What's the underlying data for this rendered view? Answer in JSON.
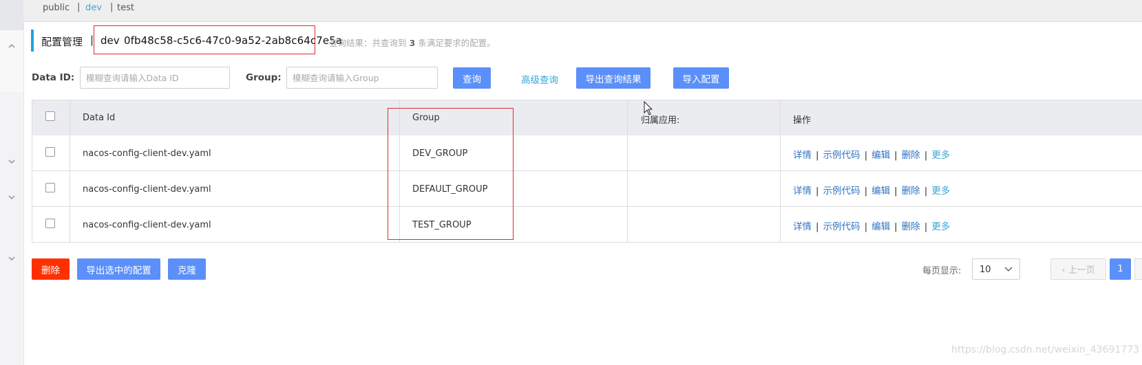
{
  "namespaces": [
    {
      "label": "public"
    },
    {
      "label": "dev"
    },
    {
      "label": "test"
    }
  ],
  "header": {
    "title": "配置管理",
    "separator": "|",
    "namespace_name": "dev",
    "namespace_id": "0fb48c58-c5c6-47c0-9a52-2ab8c64c7e5a",
    "result_prefix": "查询结果：共查询到",
    "result_count": "3",
    "result_suffix": "条满足要求的配置。"
  },
  "search": {
    "data_id_label": "Data ID:",
    "data_id_placeholder": "模糊查询请输入Data ID",
    "group_label": "Group:",
    "group_placeholder": "模糊查询请输入Group",
    "query_button": "查询",
    "advanced_link": "高级查询",
    "export_results_button": "导出查询结果",
    "import_button": "导入配置"
  },
  "table": {
    "columns": [
      "Data Id",
      "Group",
      "归属应用:",
      "操作"
    ],
    "rows": [
      {
        "data_id": "nacos-config-client-dev.yaml",
        "group": "DEV_GROUP",
        "app": ""
      },
      {
        "data_id": "nacos-config-client-dev.yaml",
        "group": "DEFAULT_GROUP",
        "app": ""
      },
      {
        "data_id": "nacos-config-client-dev.yaml",
        "group": "TEST_GROUP",
        "app": ""
      }
    ],
    "actions": {
      "detail": "详情",
      "sample": "示例代码",
      "edit": "编辑",
      "delete": "删除",
      "more": "更多"
    }
  },
  "footer": {
    "delete_button": "删除",
    "export_selected_button": "导出选中的配置",
    "clone_button": "克隆",
    "page_size_label": "每页显示:",
    "page_size_value": "10",
    "prev_button": "上一页",
    "current_page": "1"
  },
  "watermark": "https://blog.csdn.net/weixin_43691773",
  "colors": {
    "primary": "#5b8ff9",
    "danger": "#ff3000",
    "link": "#3074c3",
    "accent": "#1ba3e0",
    "highlight_box": "#e0282b"
  }
}
